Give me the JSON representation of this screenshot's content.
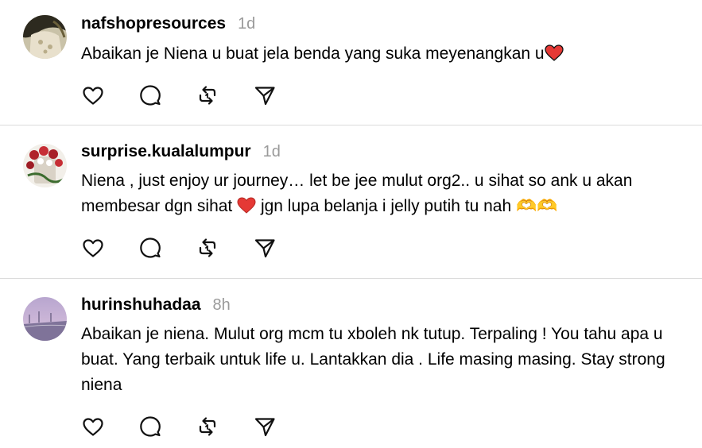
{
  "posts": [
    {
      "username": "nafshopresources",
      "time": "1d",
      "text_before": "Abaikan je Niena u buat jela benda yang suka meyenangkan u",
      "emoji": "red-heart",
      "text_after": ""
    },
    {
      "username": "surprise.kualalumpur",
      "time": "1d",
      "text_before": "Niena , just enjoy ur journey… let be jee mulut org2.. u sihat so ank u akan membesar dgn sihat ",
      "emoji": "red-heart",
      "text_after": " jgn lupa belanja i jelly putih tu nah 🫶🫶"
    },
    {
      "username": "hurinshuhadaa",
      "time": "8h",
      "text_before": "Abaikan je niena. Mulut org mcm tu xboleh nk tutup. Terpaling ! You tahu apa u buat. Yang terbaik untuk life u. Lantakkan dia . Life masing masing. Stay strong niena",
      "emoji": "",
      "text_after": ""
    }
  ],
  "actions": {
    "like": "heart-icon",
    "comment": "comment-bubble-icon",
    "repost": "repost-icon",
    "share": "send-icon"
  },
  "colors": {
    "timestamp": "#9a9a9a",
    "divider": "#dbdbdb",
    "heart_emoji": "#e53935"
  }
}
